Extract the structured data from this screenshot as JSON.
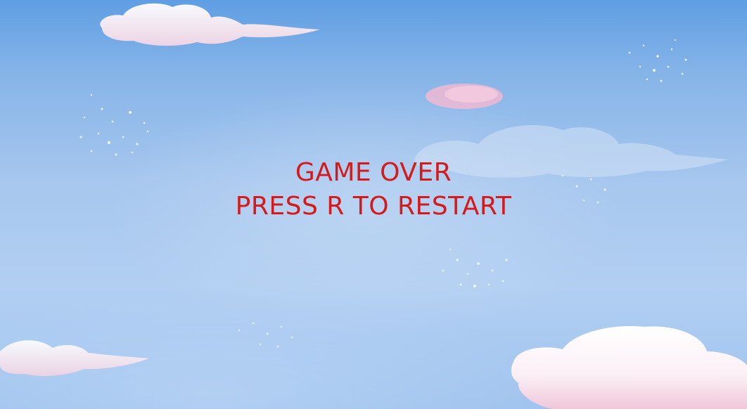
{
  "game": {
    "game_over_text": "GAME OVER",
    "restart_prompt": "PRESS R TO RESTART"
  },
  "colors": {
    "message_text": "#d41a1a",
    "sky_top": "#5f9ee3",
    "sky_mid": "#a7c7ee",
    "cloud": "#ffffff",
    "cloud_tint": "#f4c6d6"
  }
}
